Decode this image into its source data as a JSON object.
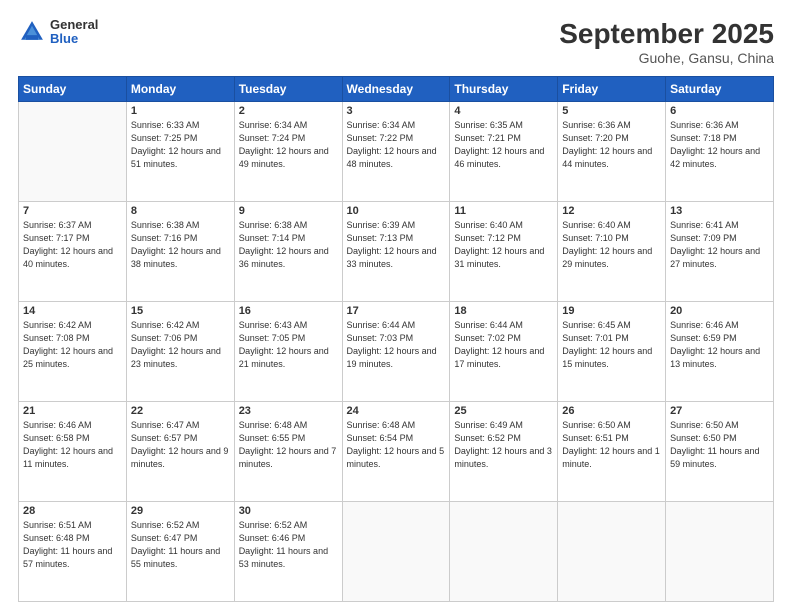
{
  "header": {
    "logo": {
      "general": "General",
      "blue": "Blue"
    },
    "title": "September 2025",
    "subtitle": "Guohe, Gansu, China"
  },
  "weekdays": [
    "Sunday",
    "Monday",
    "Tuesday",
    "Wednesday",
    "Thursday",
    "Friday",
    "Saturday"
  ],
  "weeks": [
    [
      {
        "day": "",
        "sunrise": "",
        "sunset": "",
        "daylight": ""
      },
      {
        "day": "1",
        "sunrise": "Sunrise: 6:33 AM",
        "sunset": "Sunset: 7:25 PM",
        "daylight": "Daylight: 12 hours and 51 minutes."
      },
      {
        "day": "2",
        "sunrise": "Sunrise: 6:34 AM",
        "sunset": "Sunset: 7:24 PM",
        "daylight": "Daylight: 12 hours and 49 minutes."
      },
      {
        "day": "3",
        "sunrise": "Sunrise: 6:34 AM",
        "sunset": "Sunset: 7:22 PM",
        "daylight": "Daylight: 12 hours and 48 minutes."
      },
      {
        "day": "4",
        "sunrise": "Sunrise: 6:35 AM",
        "sunset": "Sunset: 7:21 PM",
        "daylight": "Daylight: 12 hours and 46 minutes."
      },
      {
        "day": "5",
        "sunrise": "Sunrise: 6:36 AM",
        "sunset": "Sunset: 7:20 PM",
        "daylight": "Daylight: 12 hours and 44 minutes."
      },
      {
        "day": "6",
        "sunrise": "Sunrise: 6:36 AM",
        "sunset": "Sunset: 7:18 PM",
        "daylight": "Daylight: 12 hours and 42 minutes."
      }
    ],
    [
      {
        "day": "7",
        "sunrise": "Sunrise: 6:37 AM",
        "sunset": "Sunset: 7:17 PM",
        "daylight": "Daylight: 12 hours and 40 minutes."
      },
      {
        "day": "8",
        "sunrise": "Sunrise: 6:38 AM",
        "sunset": "Sunset: 7:16 PM",
        "daylight": "Daylight: 12 hours and 38 minutes."
      },
      {
        "day": "9",
        "sunrise": "Sunrise: 6:38 AM",
        "sunset": "Sunset: 7:14 PM",
        "daylight": "Daylight: 12 hours and 36 minutes."
      },
      {
        "day": "10",
        "sunrise": "Sunrise: 6:39 AM",
        "sunset": "Sunset: 7:13 PM",
        "daylight": "Daylight: 12 hours and 33 minutes."
      },
      {
        "day": "11",
        "sunrise": "Sunrise: 6:40 AM",
        "sunset": "Sunset: 7:12 PM",
        "daylight": "Daylight: 12 hours and 31 minutes."
      },
      {
        "day": "12",
        "sunrise": "Sunrise: 6:40 AM",
        "sunset": "Sunset: 7:10 PM",
        "daylight": "Daylight: 12 hours and 29 minutes."
      },
      {
        "day": "13",
        "sunrise": "Sunrise: 6:41 AM",
        "sunset": "Sunset: 7:09 PM",
        "daylight": "Daylight: 12 hours and 27 minutes."
      }
    ],
    [
      {
        "day": "14",
        "sunrise": "Sunrise: 6:42 AM",
        "sunset": "Sunset: 7:08 PM",
        "daylight": "Daylight: 12 hours and 25 minutes."
      },
      {
        "day": "15",
        "sunrise": "Sunrise: 6:42 AM",
        "sunset": "Sunset: 7:06 PM",
        "daylight": "Daylight: 12 hours and 23 minutes."
      },
      {
        "day": "16",
        "sunrise": "Sunrise: 6:43 AM",
        "sunset": "Sunset: 7:05 PM",
        "daylight": "Daylight: 12 hours and 21 minutes."
      },
      {
        "day": "17",
        "sunrise": "Sunrise: 6:44 AM",
        "sunset": "Sunset: 7:03 PM",
        "daylight": "Daylight: 12 hours and 19 minutes."
      },
      {
        "day": "18",
        "sunrise": "Sunrise: 6:44 AM",
        "sunset": "Sunset: 7:02 PM",
        "daylight": "Daylight: 12 hours and 17 minutes."
      },
      {
        "day": "19",
        "sunrise": "Sunrise: 6:45 AM",
        "sunset": "Sunset: 7:01 PM",
        "daylight": "Daylight: 12 hours and 15 minutes."
      },
      {
        "day": "20",
        "sunrise": "Sunrise: 6:46 AM",
        "sunset": "Sunset: 6:59 PM",
        "daylight": "Daylight: 12 hours and 13 minutes."
      }
    ],
    [
      {
        "day": "21",
        "sunrise": "Sunrise: 6:46 AM",
        "sunset": "Sunset: 6:58 PM",
        "daylight": "Daylight: 12 hours and 11 minutes."
      },
      {
        "day": "22",
        "sunrise": "Sunrise: 6:47 AM",
        "sunset": "Sunset: 6:57 PM",
        "daylight": "Daylight: 12 hours and 9 minutes."
      },
      {
        "day": "23",
        "sunrise": "Sunrise: 6:48 AM",
        "sunset": "Sunset: 6:55 PM",
        "daylight": "Daylight: 12 hours and 7 minutes."
      },
      {
        "day": "24",
        "sunrise": "Sunrise: 6:48 AM",
        "sunset": "Sunset: 6:54 PM",
        "daylight": "Daylight: 12 hours and 5 minutes."
      },
      {
        "day": "25",
        "sunrise": "Sunrise: 6:49 AM",
        "sunset": "Sunset: 6:52 PM",
        "daylight": "Daylight: 12 hours and 3 minutes."
      },
      {
        "day": "26",
        "sunrise": "Sunrise: 6:50 AM",
        "sunset": "Sunset: 6:51 PM",
        "daylight": "Daylight: 12 hours and 1 minute."
      },
      {
        "day": "27",
        "sunrise": "Sunrise: 6:50 AM",
        "sunset": "Sunset: 6:50 PM",
        "daylight": "Daylight: 11 hours and 59 minutes."
      }
    ],
    [
      {
        "day": "28",
        "sunrise": "Sunrise: 6:51 AM",
        "sunset": "Sunset: 6:48 PM",
        "daylight": "Daylight: 11 hours and 57 minutes."
      },
      {
        "day": "29",
        "sunrise": "Sunrise: 6:52 AM",
        "sunset": "Sunset: 6:47 PM",
        "daylight": "Daylight: 11 hours and 55 minutes."
      },
      {
        "day": "30",
        "sunrise": "Sunrise: 6:52 AM",
        "sunset": "Sunset: 6:46 PM",
        "daylight": "Daylight: 11 hours and 53 minutes."
      },
      {
        "day": "",
        "sunrise": "",
        "sunset": "",
        "daylight": ""
      },
      {
        "day": "",
        "sunrise": "",
        "sunset": "",
        "daylight": ""
      },
      {
        "day": "",
        "sunrise": "",
        "sunset": "",
        "daylight": ""
      },
      {
        "day": "",
        "sunrise": "",
        "sunset": "",
        "daylight": ""
      }
    ]
  ]
}
